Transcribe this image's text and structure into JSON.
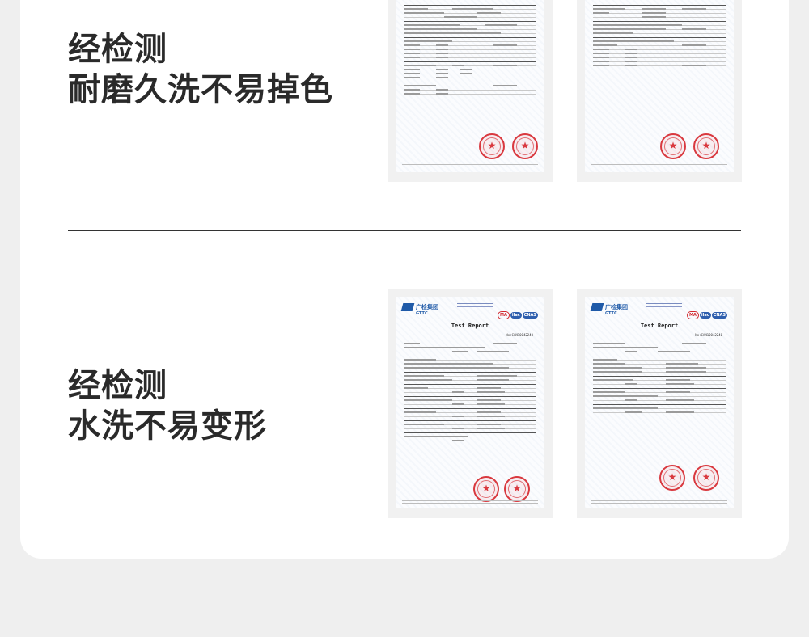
{
  "section1": {
    "line1": "经检测",
    "line2": "耐磨久洗不易掉色"
  },
  "section2": {
    "line1": "经检测",
    "line2": "水洗不易变形"
  },
  "report": {
    "title": "Test Report",
    "number": "No:CAN10042240",
    "logo_text": "广检集团",
    "logo_sub": "GTTC",
    "cert_ma": "MA",
    "cert_ilac": "ilac",
    "cert_cnas": "CNAS"
  },
  "colors": {
    "stamp": "#d9393f",
    "logo": "#1f5aa8"
  }
}
